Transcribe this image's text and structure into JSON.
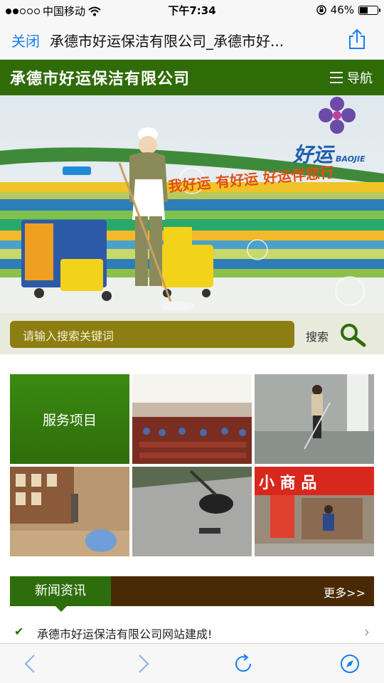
{
  "status_bar": {
    "carrier": "中国移动",
    "time": "下午7:34",
    "battery": "46%",
    "battery_level": 0.46
  },
  "browser": {
    "close_label": "关闭",
    "page_title": "承德市好运保洁有限公司_承德市好..."
  },
  "site_header": {
    "logo_text": "承德市好运保洁有限公司",
    "nav_label": "导航"
  },
  "banner": {
    "brand_text": "好运",
    "brand_sub": "BAOJIE",
    "slogan": "我好运 有好运 好运伴您行"
  },
  "search": {
    "placeholder": "请输入搜索关键词",
    "button_label": "搜索"
  },
  "services": {
    "title": "服务项目",
    "photo_shop_sign": "小 商 品"
  },
  "news": {
    "tab_label": "新闻资讯",
    "more_label": "更多>>",
    "items": [
      {
        "title": "承德市好运保洁有限公司网站建成!"
      }
    ]
  },
  "colors": {
    "header_green": "#2f6b06",
    "news_brown": "#4a2a06",
    "search_olive": "#8c7e12",
    "ios_blue": "#1a7ef2"
  }
}
